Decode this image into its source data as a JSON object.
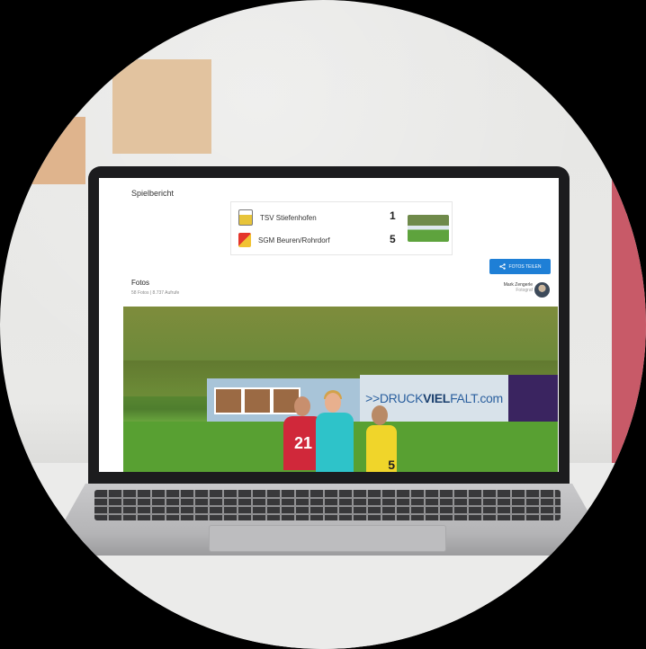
{
  "screen": {
    "section_title": "Spielbericht",
    "match": {
      "home_team": "TSV Stiefenhofen",
      "home_score": "1",
      "away_team": "SGM Beuren/Rohrdorf",
      "away_score": "5"
    },
    "share_button_label": "FOTOS TEILEN",
    "photos": {
      "title": "Fotos",
      "subtitle": "58 Fotos | 8.737 Aufrufe",
      "photographer_name": "Mark Zengerle",
      "photographer_role": "Fotograf"
    },
    "photo_banner_text_prefix": ">>DRUCK",
    "photo_banner_text_bold": "VIEL",
    "photo_banner_text_suffix": "FALT.com",
    "jersey_number_red": "21",
    "jersey_number_yellow": "5"
  },
  "colors": {
    "accent": "#1e7fd6",
    "background": "#000000",
    "sticky_note": "#e2c39f"
  },
  "icons": {
    "share": "share-icon"
  }
}
